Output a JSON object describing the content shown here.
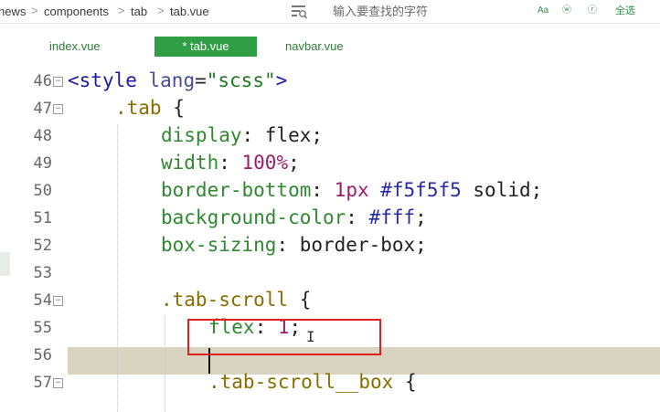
{
  "breadcrumb": {
    "items": [
      "news",
      "components",
      "tab",
      "tab.vue"
    ],
    "separator": ">"
  },
  "search": {
    "placeholder": "输入要查找的字符",
    "icon": "search-replace-icon"
  },
  "toolbar": {
    "case_label": "Aa",
    "word_label": "ⓦ",
    "regex_label": "ⓡ",
    "select_all_label": "全选"
  },
  "tabs": [
    {
      "label": "index.vue",
      "active": false
    },
    {
      "label": "* tab.vue",
      "active": true
    },
    {
      "label": "navbar.vue",
      "active": false
    }
  ],
  "colors": {
    "accent": "#2f9e44",
    "current_line": "#d9d3c1",
    "annotation": "#e02020"
  },
  "editor": {
    "lines": [
      {
        "n": "46",
        "fold": "⊟"
      },
      {
        "n": "47",
        "fold": "⊟"
      },
      {
        "n": "48",
        "fold": ""
      },
      {
        "n": "49",
        "fold": ""
      },
      {
        "n": "50",
        "fold": ""
      },
      {
        "n": "51",
        "fold": ""
      },
      {
        "n": "52",
        "fold": ""
      },
      {
        "n": "53",
        "fold": ""
      },
      {
        "n": "54",
        "fold": "⊟"
      },
      {
        "n": "55",
        "fold": ""
      },
      {
        "n": "56",
        "fold": ""
      },
      {
        "n": "57",
        "fold": "⊟"
      }
    ],
    "code": {
      "l46_open": "<",
      "l46_tag": "style",
      "l46_attr": " lang",
      "l46_eq": "=",
      "l46_str": "\"scss\"",
      "l46_close": ">",
      "l47_sel": ".tab",
      "l47_brace": " {",
      "l48_prop": "display",
      "l48_val": ": flex;",
      "l49_prop": "width",
      "l49_colon": ": ",
      "l49_num": "100%",
      "l49_semi": ";",
      "l50_prop": "border-bottom",
      "l50_colon": ": ",
      "l50_num": "1px",
      "l50_hex": " #f5f5f5",
      "l50_rest": " solid;",
      "l51_prop": "background-color",
      "l51_colon": ": ",
      "l51_hex": "#fff",
      "l51_semi": ";",
      "l52_prop": "box-sizing",
      "l52_val": ": border-box;",
      "l54_sel": ".tab-scroll",
      "l54_brace": " {",
      "l55_prop": "flex",
      "l55_colon": ": ",
      "l55_num": "1",
      "l55_semi": ";",
      "l57_sel": ".tab-scroll__box",
      "l57_brace": " {"
    }
  }
}
